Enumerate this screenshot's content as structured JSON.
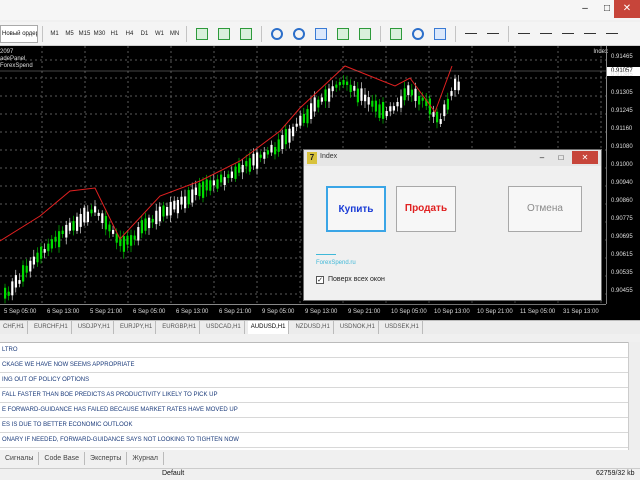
{
  "colors": {
    "bull": "#00dd00",
    "bear": "#ffffff",
    "zigzag": "#e02020",
    "grid": "#5a5a5a",
    "accent": "#3aa5e6"
  },
  "window": {
    "minimize_icon": "minimize-icon",
    "maximize_icon": "maximize-icon",
    "close_icon": "close-icon"
  },
  "toolbar": {
    "new_order_label": "Новый ордер",
    "timeframes": [
      "M1",
      "M5",
      "M15",
      "M30",
      "H1",
      "H4",
      "D1",
      "W1",
      "MN"
    ]
  },
  "chart": {
    "info_line1": "2097",
    "info_line2": "adePanel",
    "info_line3": "ForexSpend",
    "indicator_name": "Index",
    "current_price": "0.91057",
    "price_labels": [
      "0.91465",
      "0.91385",
      "0.91305",
      "0.91245",
      "0.91160",
      "0.91080",
      "0.91000",
      "0.90940",
      "0.90860",
      "0.90775",
      "0.90695",
      "0.90615",
      "0.90535",
      "0.90455"
    ],
    "time_labels": [
      "5 Sep 05:00",
      "6 Sep 13:00",
      "5 Sep 21:00",
      "6 Sep 05:00",
      "6 Sep 13:00",
      "6 Sep 21:00",
      "9 Sep 05:00",
      "9 Sep 13:00",
      "9 Sep 21:00",
      "10 Sep 05:00",
      "10 Sep 13:00",
      "10 Sep 21:00",
      "11 Sep 05:00",
      "31 Sep 13:00"
    ]
  },
  "symbol_tabs": [
    "CHF,H1",
    "EURCHF,H1",
    "USDJPY,H1",
    "EURJPY,H1",
    "EURGBP,H1",
    "USDCAD,H1",
    "AUDUSD,H1",
    "NZDUSD,H1",
    "USDNOK,H1",
    "USDSEK,H1"
  ],
  "active_symbol_index": 6,
  "news": [
    "LTRO",
    "CKAGE WE HAVE NOW SEEMS APPROPRIATE",
    "ING OUT OF POLICY OPTIONS",
    "FALL FASTER THAN BOE PREDICTS AS PRODUCTIVITY LIKELY TO PICK UP",
    "E FORWARD-GUIDANCE HAS FAILED BECAUSE MARKET RATES HAVE MOVED UP",
    "ES IS DUE TO BETTER ECONOMIC OUTLOOK",
    "ONARY IF NEEDED, FORWARD-GUIDANCE SAYS NOT LOOKING TO TIGHTEN NOW"
  ],
  "bottom_tabs": [
    "Сигналы",
    "Code Base",
    "Эксперты",
    "Журнал"
  ],
  "status": {
    "profile": "Default",
    "traffic": "62759/32 kb"
  },
  "dialog": {
    "title": "Index",
    "logo": "7",
    "buy_label": "Купить",
    "sell_label": "Продать",
    "cancel_label": "Отмена",
    "link_text": "ForexSpend.ru",
    "always_on_top_label": "Поверх всех окон",
    "always_on_top": true,
    "check_mark": "✓"
  }
}
